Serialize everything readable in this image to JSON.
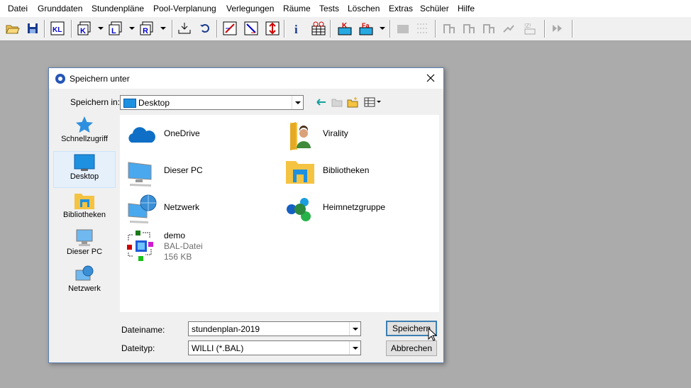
{
  "menu": [
    "Datei",
    "Grunddaten",
    "Stundenpläne",
    "Pool-Verplanung",
    "Verlegungen",
    "Räume",
    "Tests",
    "Löschen",
    "Extras",
    "Schüler",
    "Hilfe"
  ],
  "dialog": {
    "title": "Speichern unter",
    "save_in_label": "Speichern in:",
    "save_in_value": "Desktop",
    "places": [
      "Schnellzugriff",
      "Desktop",
      "Bibliotheken",
      "Dieser PC",
      "Netzwerk"
    ],
    "selected_place": "Desktop",
    "files": [
      {
        "name": "OneDrive",
        "icon": "onedrive-icon"
      },
      {
        "name": "Virality",
        "icon": "user-folder-icon"
      },
      {
        "name": "Dieser PC",
        "icon": "computer-icon"
      },
      {
        "name": "Bibliotheken",
        "icon": "libraries-icon"
      },
      {
        "name": "Netzwerk",
        "icon": "network-icon"
      },
      {
        "name": "Heimnetzgruppe",
        "icon": "homegroup-icon"
      },
      {
        "name": "demo",
        "type": "BAL-Datei",
        "size": "156 KB",
        "icon": "bal-file-icon"
      }
    ],
    "filename_label": "Dateiname:",
    "filename_value": "stundenplan-2019",
    "filetype_label": "Dateityp:",
    "filetype_value": "WILLI (*.BAL)",
    "save_button": "Speichern",
    "cancel_button": "Abbrechen"
  },
  "colors": {
    "accent": "#0078d7",
    "folder": "#f5c342",
    "desktop_bg": "#ababab"
  }
}
